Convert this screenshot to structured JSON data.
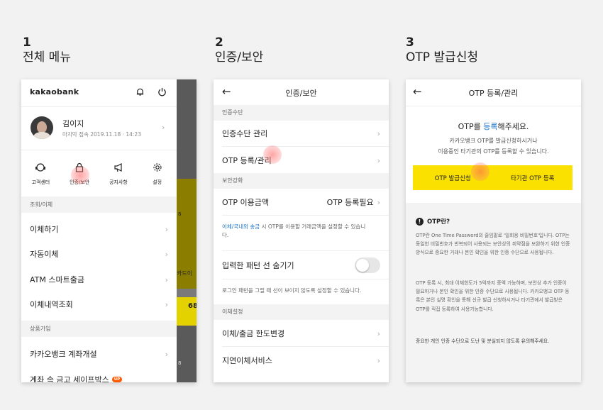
{
  "steps": [
    {
      "num": "1",
      "title": "전체 메뉴"
    },
    {
      "num": "2",
      "title": "인증/보안"
    },
    {
      "num": "3",
      "title": "OTP 발급신청"
    }
  ],
  "screen1": {
    "logo": "kakaobank",
    "user_name": "김이지",
    "last_login": "마지막 접속 2019.11.18 · 14:23",
    "quick": [
      {
        "label": "고객센터",
        "icon": "headset-icon"
      },
      {
        "label": "인증/보안",
        "icon": "lock-icon"
      },
      {
        "label": "공지사항",
        "icon": "megaphone-icon"
      },
      {
        "label": "설정",
        "icon": "gear-icon"
      }
    ],
    "section1": "조회/이체",
    "items1": [
      "이체하기",
      "자동이체",
      "ATM 스마트출금",
      "이체내역조회"
    ],
    "section2": "상품가입",
    "items2": [
      "카카오뱅크 계좌개설",
      "계좌 속 금고 세이프박스"
    ],
    "badge": "UP",
    "bg_text1": "카드이",
    "bg_text2": "68",
    "bg_text3": "8",
    "bg_text4": "8"
  },
  "screen2": {
    "title": "인증/보안",
    "sec1": "인증수단",
    "item_auth_manage": "인증수단 관리",
    "item_otp_register": "OTP 등록/관리",
    "sec2": "보안강화",
    "item_otp_amount": "OTP 이용금액",
    "item_otp_amount_value": "OTP 등록필요",
    "note1_link": "이체/국내외 송금",
    "note1_rest": " 시 OTP를 이용할 거래금액을 설정할 수 있습니다.",
    "item_pattern": "입력한 패턴 선 숨기기",
    "note2": "로그인 패턴을 그릴 때 선이 보이지 않도록 설정할 수 있습니다.",
    "sec3": "이체설정",
    "item_limit": "이체/출금 한도변경",
    "item_delay": "지연이체서비스"
  },
  "screen3": {
    "title": "OTP 등록/관리",
    "headline_pre": "OTP를 ",
    "headline_link": "등록",
    "headline_post": "해주세요.",
    "desc1": "카카오뱅크 OTP를 발급신청하시거나",
    "desc2": "이용중인 타기관의 OTP를 등록할 수 있습니다.",
    "btn_apply": "OTP 발급신청",
    "btn_other": "타기관 OTP 등록",
    "info_title": "OTP란?",
    "info_p1": "OTP란 One Time Password의 줄임말로 '일회용 비밀번호'입니다. OTP는 동일한 비밀번호가 반복되어 사용되는 보안상의 취약점을 보완하기 위한 인증 방식으로 중요한 거래나 본인 확인을 위한 인증 수단으로 사용됩니다.",
    "info_p2": "OTP 등록 시, 최대 이체한도가 5억까지 증액 가능하며, 보안상 추가 인증이 필요하거나 본인 확인을 위한 인증 수단으로 사용됩니다. 카카오뱅크 OTP 등록은 본인 실명 확인을 통해 신규 발급 신청하시거나 타기관에서 발급받은 OTP를 직접 등록하여 사용가능합니다.",
    "info_p3": "중요한 개인 인증 수단으로 도난 및 분실되지 않도록 유의해주세요."
  },
  "colors": {
    "accent": "#fae100",
    "link": "#1a73c8",
    "badge": "#ff5a00",
    "overlay": "#555555"
  }
}
